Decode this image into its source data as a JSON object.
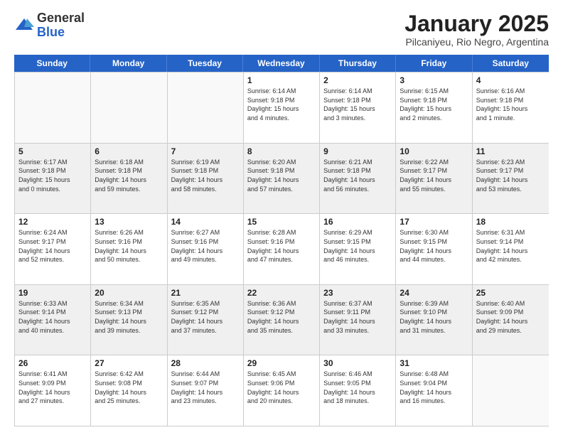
{
  "header": {
    "logo_general": "General",
    "logo_blue": "Blue",
    "title": "January 2025",
    "subtitle": "Pilcaniyeu, Rio Negro, Argentina"
  },
  "weekdays": [
    "Sunday",
    "Monday",
    "Tuesday",
    "Wednesday",
    "Thursday",
    "Friday",
    "Saturday"
  ],
  "weeks": [
    [
      {
        "day": "",
        "info": ""
      },
      {
        "day": "",
        "info": ""
      },
      {
        "day": "",
        "info": ""
      },
      {
        "day": "1",
        "info": "Sunrise: 6:14 AM\nSunset: 9:18 PM\nDaylight: 15 hours\nand 4 minutes."
      },
      {
        "day": "2",
        "info": "Sunrise: 6:14 AM\nSunset: 9:18 PM\nDaylight: 15 hours\nand 3 minutes."
      },
      {
        "day": "3",
        "info": "Sunrise: 6:15 AM\nSunset: 9:18 PM\nDaylight: 15 hours\nand 2 minutes."
      },
      {
        "day": "4",
        "info": "Sunrise: 6:16 AM\nSunset: 9:18 PM\nDaylight: 15 hours\nand 1 minute."
      }
    ],
    [
      {
        "day": "5",
        "info": "Sunrise: 6:17 AM\nSunset: 9:18 PM\nDaylight: 15 hours\nand 0 minutes."
      },
      {
        "day": "6",
        "info": "Sunrise: 6:18 AM\nSunset: 9:18 PM\nDaylight: 14 hours\nand 59 minutes."
      },
      {
        "day": "7",
        "info": "Sunrise: 6:19 AM\nSunset: 9:18 PM\nDaylight: 14 hours\nand 58 minutes."
      },
      {
        "day": "8",
        "info": "Sunrise: 6:20 AM\nSunset: 9:18 PM\nDaylight: 14 hours\nand 57 minutes."
      },
      {
        "day": "9",
        "info": "Sunrise: 6:21 AM\nSunset: 9:18 PM\nDaylight: 14 hours\nand 56 minutes."
      },
      {
        "day": "10",
        "info": "Sunrise: 6:22 AM\nSunset: 9:17 PM\nDaylight: 14 hours\nand 55 minutes."
      },
      {
        "day": "11",
        "info": "Sunrise: 6:23 AM\nSunset: 9:17 PM\nDaylight: 14 hours\nand 53 minutes."
      }
    ],
    [
      {
        "day": "12",
        "info": "Sunrise: 6:24 AM\nSunset: 9:17 PM\nDaylight: 14 hours\nand 52 minutes."
      },
      {
        "day": "13",
        "info": "Sunrise: 6:26 AM\nSunset: 9:16 PM\nDaylight: 14 hours\nand 50 minutes."
      },
      {
        "day": "14",
        "info": "Sunrise: 6:27 AM\nSunset: 9:16 PM\nDaylight: 14 hours\nand 49 minutes."
      },
      {
        "day": "15",
        "info": "Sunrise: 6:28 AM\nSunset: 9:16 PM\nDaylight: 14 hours\nand 47 minutes."
      },
      {
        "day": "16",
        "info": "Sunrise: 6:29 AM\nSunset: 9:15 PM\nDaylight: 14 hours\nand 46 minutes."
      },
      {
        "day": "17",
        "info": "Sunrise: 6:30 AM\nSunset: 9:15 PM\nDaylight: 14 hours\nand 44 minutes."
      },
      {
        "day": "18",
        "info": "Sunrise: 6:31 AM\nSunset: 9:14 PM\nDaylight: 14 hours\nand 42 minutes."
      }
    ],
    [
      {
        "day": "19",
        "info": "Sunrise: 6:33 AM\nSunset: 9:14 PM\nDaylight: 14 hours\nand 40 minutes."
      },
      {
        "day": "20",
        "info": "Sunrise: 6:34 AM\nSunset: 9:13 PM\nDaylight: 14 hours\nand 39 minutes."
      },
      {
        "day": "21",
        "info": "Sunrise: 6:35 AM\nSunset: 9:12 PM\nDaylight: 14 hours\nand 37 minutes."
      },
      {
        "day": "22",
        "info": "Sunrise: 6:36 AM\nSunset: 9:12 PM\nDaylight: 14 hours\nand 35 minutes."
      },
      {
        "day": "23",
        "info": "Sunrise: 6:37 AM\nSunset: 9:11 PM\nDaylight: 14 hours\nand 33 minutes."
      },
      {
        "day": "24",
        "info": "Sunrise: 6:39 AM\nSunset: 9:10 PM\nDaylight: 14 hours\nand 31 minutes."
      },
      {
        "day": "25",
        "info": "Sunrise: 6:40 AM\nSunset: 9:09 PM\nDaylight: 14 hours\nand 29 minutes."
      }
    ],
    [
      {
        "day": "26",
        "info": "Sunrise: 6:41 AM\nSunset: 9:09 PM\nDaylight: 14 hours\nand 27 minutes."
      },
      {
        "day": "27",
        "info": "Sunrise: 6:42 AM\nSunset: 9:08 PM\nDaylight: 14 hours\nand 25 minutes."
      },
      {
        "day": "28",
        "info": "Sunrise: 6:44 AM\nSunset: 9:07 PM\nDaylight: 14 hours\nand 23 minutes."
      },
      {
        "day": "29",
        "info": "Sunrise: 6:45 AM\nSunset: 9:06 PM\nDaylight: 14 hours\nand 20 minutes."
      },
      {
        "day": "30",
        "info": "Sunrise: 6:46 AM\nSunset: 9:05 PM\nDaylight: 14 hours\nand 18 minutes."
      },
      {
        "day": "31",
        "info": "Sunrise: 6:48 AM\nSunset: 9:04 PM\nDaylight: 14 hours\nand 16 minutes."
      },
      {
        "day": "",
        "info": ""
      }
    ]
  ]
}
